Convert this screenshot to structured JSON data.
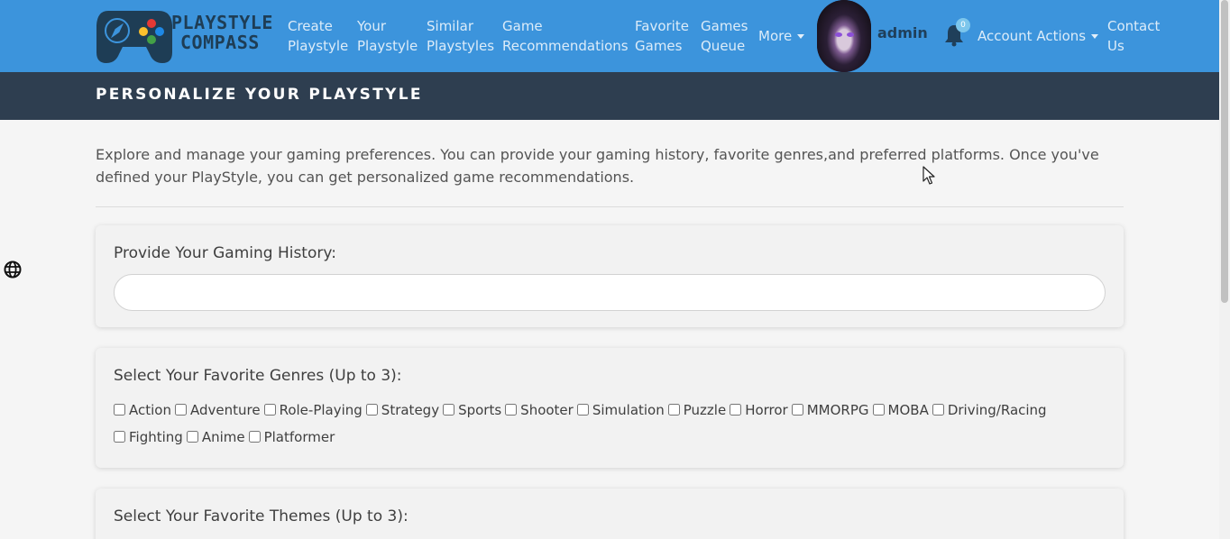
{
  "brand": {
    "line1": "PLAYSTYLE",
    "line2": "COMPASS",
    "colors": {
      "controller": "#1e3d55",
      "red": "#e53935",
      "green": "#43a047",
      "yellow": "#fbc02d",
      "blue": "#1e88e5"
    }
  },
  "nav": {
    "create_playstyle": {
      "line1": "Create",
      "line2": "Playstyle"
    },
    "your_playstyle": {
      "line1": "Your",
      "line2": "Playstyle"
    },
    "similar_playstyles": {
      "line1": "Similar",
      "line2": "Playstyles"
    },
    "game_recommendations": {
      "line1": "Game",
      "line2": "Recommendations"
    },
    "favorite_games": {
      "line1": "Favorite",
      "line2": "Games"
    },
    "games_queue": {
      "line1": "Games",
      "line2": "Queue"
    },
    "more": "More",
    "username": "admin",
    "notifications_count": "0",
    "account_actions": "Account Actions",
    "contact_us": {
      "line1": "Contact",
      "line2": "Us"
    }
  },
  "header": {
    "title": "PERSONALIZE YOUR PLAYSTYLE"
  },
  "intro": "Explore and manage your gaming preferences. You can provide your gaming history, favorite genres,and preferred platforms. Once you've defined your PlayStyle, you can get personalized game recommendations.",
  "history": {
    "label": "Provide Your Gaming History:",
    "value": ""
  },
  "genres": {
    "label": "Select Your Favorite Genres (Up to 3):",
    "options": [
      "Action",
      "Adventure",
      "Role-Playing",
      "Strategy",
      "Sports",
      "Shooter",
      "Simulation",
      "Puzzle",
      "Horror",
      "MMORPG",
      "MOBA",
      "Driving/Racing",
      "Fighting",
      "Anime",
      "Platformer"
    ]
  },
  "themes": {
    "label": "Select Your Favorite Themes (Up to 3):"
  },
  "icons": {
    "globe": "globe-icon",
    "bell": "bell-icon",
    "cursor": "mouse-cursor-icon"
  },
  "theme_colors": {
    "navbar": "#3c94dc",
    "header_bar": "#2e3e50",
    "badge": "#7cc6ec"
  }
}
